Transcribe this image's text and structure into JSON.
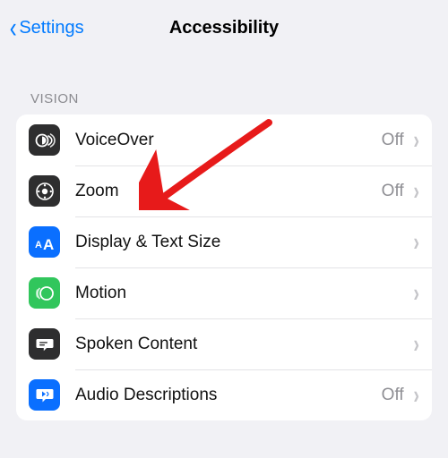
{
  "nav": {
    "back_label": "Settings",
    "title": "Accessibility"
  },
  "section": {
    "header": "VISION",
    "status_off": "Off",
    "items": [
      {
        "label": "VoiceOver",
        "value": "Off"
      },
      {
        "label": "Zoom",
        "value": "Off"
      },
      {
        "label": "Display & Text Size",
        "value": ""
      },
      {
        "label": "Motion",
        "value": ""
      },
      {
        "label": "Spoken Content",
        "value": ""
      },
      {
        "label": "Audio Descriptions",
        "value": "Off"
      }
    ]
  },
  "icon_colors": {
    "voiceover": "#2e2e2f",
    "zoom": "#2e2e2f",
    "display": "#0a6fff",
    "motion": "#31c65c",
    "spoken": "#2e2e2f",
    "audio": "#0a6fff"
  }
}
